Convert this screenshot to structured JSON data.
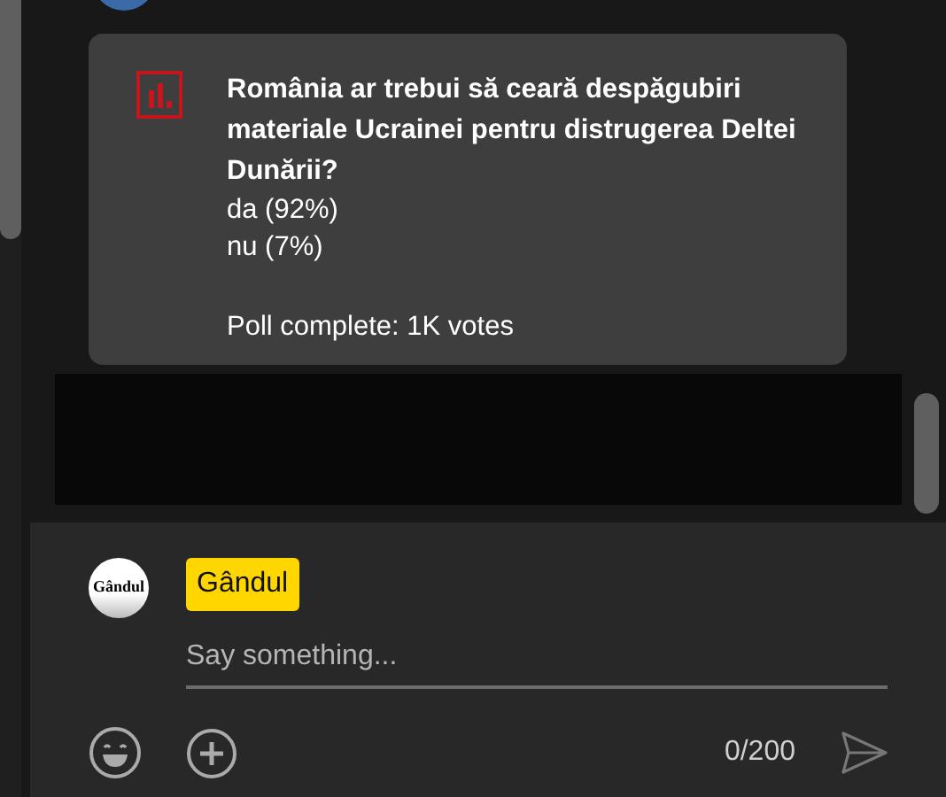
{
  "poll": {
    "question": "România ar trebui să ceară despăgubiri materiale Ucrainei pentru distrugerea Deltei Dunării?",
    "options": [
      {
        "label": "da (92%)"
      },
      {
        "label": "nu (7%)"
      }
    ],
    "status": "Poll complete: 1K votes"
  },
  "composer": {
    "avatar_text": "Gândul",
    "author": "Gândul",
    "placeholder": "Say something...",
    "counter": "0/200"
  }
}
